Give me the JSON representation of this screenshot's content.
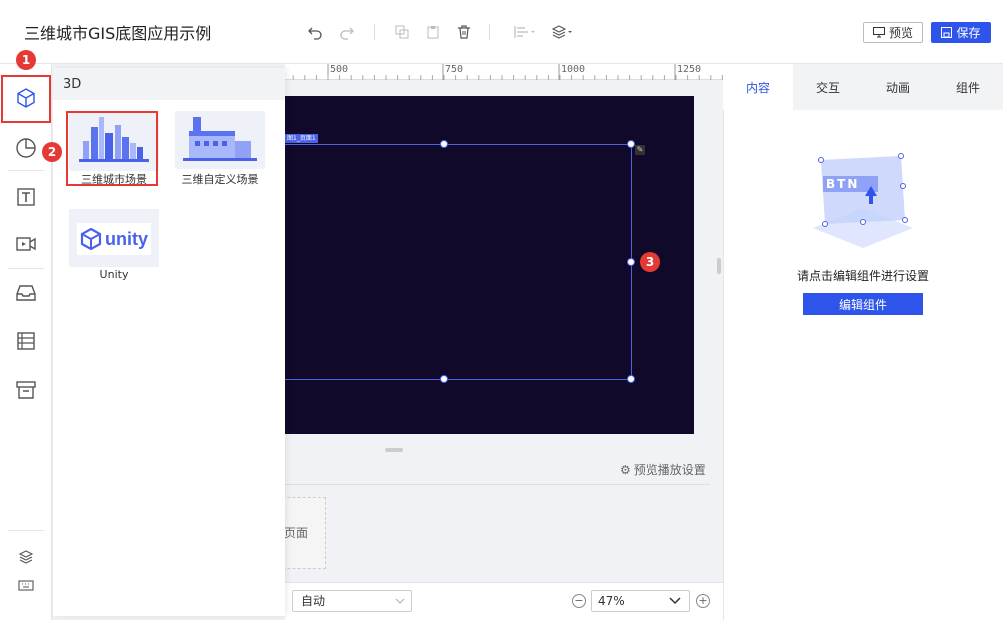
{
  "header": {
    "title": "三维城市GIS底图应用示例",
    "preview_label": "预览",
    "save_label": "保存"
  },
  "panel": {
    "title": "3D",
    "items": [
      {
        "label": "三维城市场景",
        "icon": "city-scene-icon"
      },
      {
        "label": "三维自定义场景",
        "icon": "factory-scene-icon"
      },
      {
        "label": "Unity",
        "icon": "unity-logo",
        "logo_text": "unity"
      }
    ]
  },
  "ruler": {
    "marks": [
      "500",
      "750",
      "1000",
      "1250"
    ]
  },
  "canvas": {
    "selection_tag": "图1_页面1",
    "background": "#10092a"
  },
  "annotations": {
    "badge1": "1",
    "badge2": "2",
    "badge3": "3"
  },
  "page_strip": {
    "play_settings": "预览播放设置",
    "page_label": "页面"
  },
  "bottom": {
    "scale_mode": "自动",
    "zoom": "47%"
  },
  "right_panel": {
    "tabs": [
      "内容",
      "交互",
      "动画",
      "组件"
    ],
    "empty_text": "请点击编辑组件进行设置",
    "edit_button": "编辑组件",
    "illustration_text": "BTN"
  },
  "colors": {
    "accent": "#2f54eb",
    "annotation": "#e53935"
  }
}
